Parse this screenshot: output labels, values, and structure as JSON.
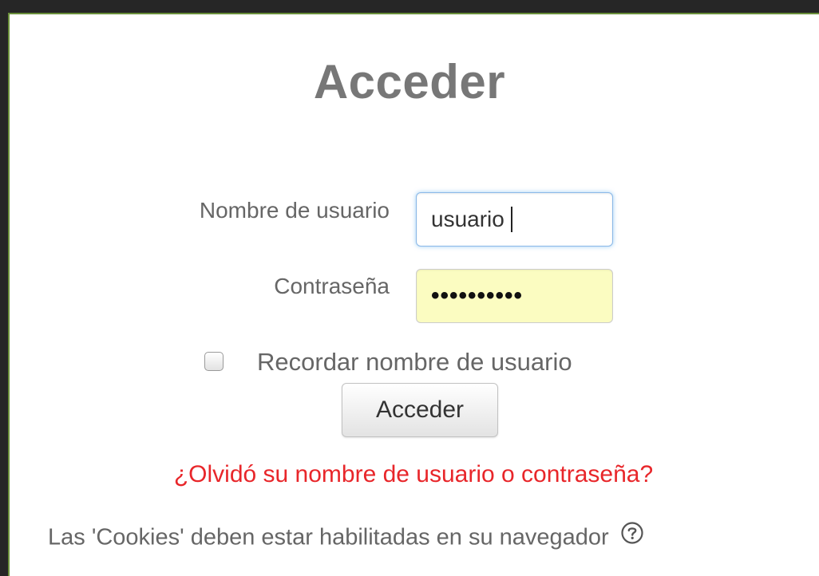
{
  "login": {
    "title": "Acceder",
    "username_label": "Nombre de usuario",
    "username_value": "usuario",
    "password_label": "Contraseña",
    "password_value": "••••••••••",
    "remember_label": "Recordar nombre de usuario",
    "remember_checked": false,
    "submit_label": "Acceder",
    "forgot_link": "¿Olvidó su nombre de usuario o contraseña?",
    "cookies_notice": "Las 'Cookies' deben estar habilitadas en su navegador",
    "help_icon": "help-circle-icon"
  },
  "colors": {
    "title": "#777777",
    "link": "#e8262a",
    "password_autofill_bg": "#fbfcc1",
    "focus_border": "#8ab8e8",
    "frame_border": "#6a8f3a"
  }
}
